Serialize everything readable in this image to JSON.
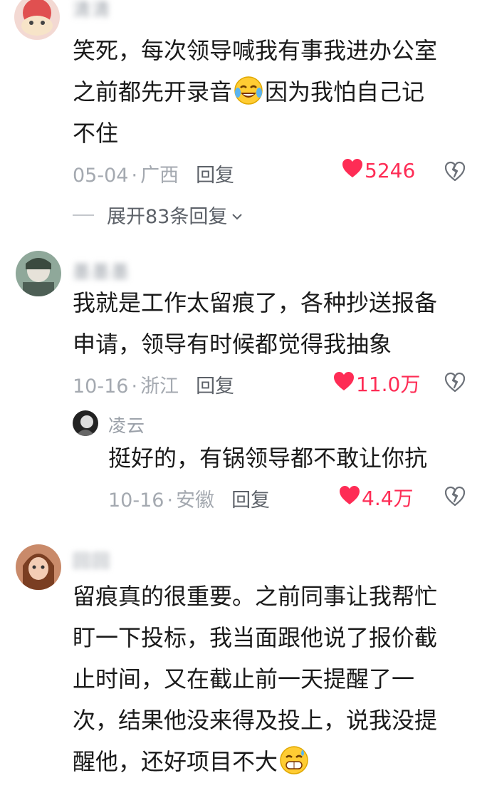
{
  "comments": [
    {
      "username": "清清",
      "lines": [
        "笑死，每次领导喊我有事我进办公室",
        "之前都先开录音",
        "因为我怕自己记",
        "不住"
      ],
      "emoji": "crying-laughing-emoji",
      "date": "05-04",
      "location": "广西",
      "reply_label": "回复",
      "likes": "5246",
      "expand_label": "展开83条回复"
    },
    {
      "username": "墨墨墨",
      "lines": [
        "我就是工作太留痕了，各种抄送报备",
        "申请，领导有时候都觉得我抽象"
      ],
      "date": "10-16",
      "location": "浙江",
      "reply_label": "回复",
      "likes": "11.0万",
      "reply": {
        "username": "凌云",
        "text": "挺好的，有锅领导都不敢让你抗",
        "date": "10-16",
        "location": "安徽",
        "reply_label": "回复",
        "likes": "4.4万"
      }
    },
    {
      "username": "回回",
      "lines": [
        "留痕真的很重要。之前同事让我帮忙",
        "盯一下投标，我当面跟他说了报价截",
        "止时间，又在截止前一天提醒了一",
        "次，结果他没来得及投上，说我没提",
        "醒他，还好项目不大"
      ],
      "emoji": "grinning-sweat-emoji"
    }
  ],
  "colors": {
    "like": "#fe2c55",
    "meta": "#a4a9b0",
    "text": "#1a1a1a"
  }
}
